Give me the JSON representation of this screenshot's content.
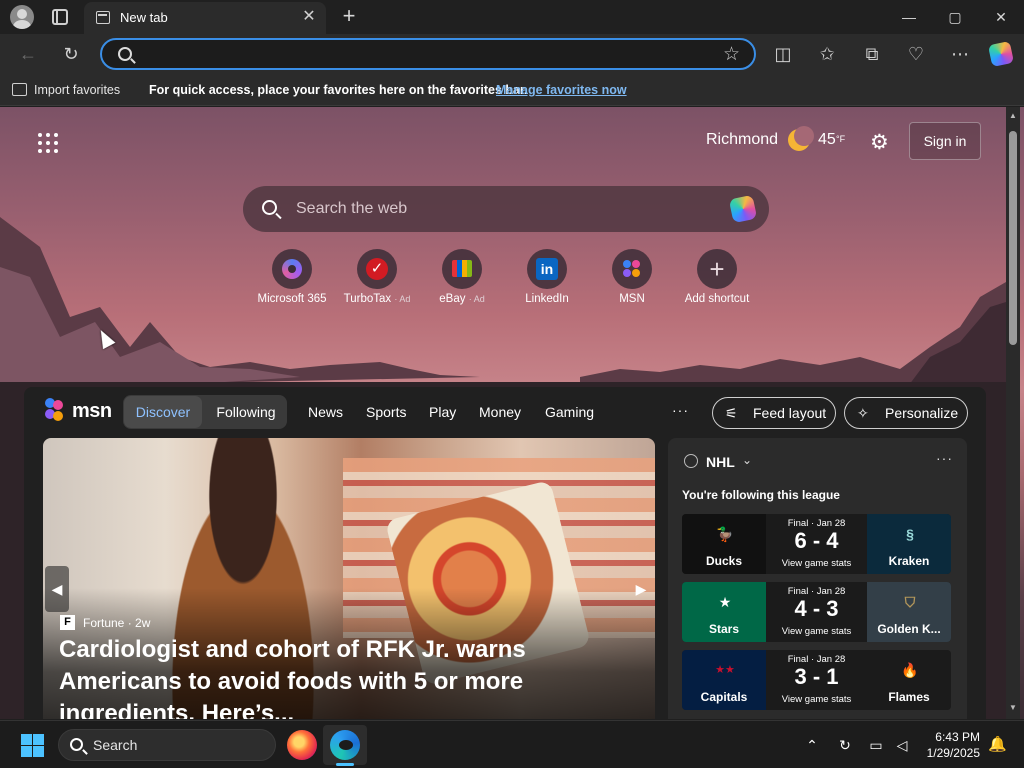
{
  "browser": {
    "tab": {
      "title": "New tab"
    },
    "window_controls": {
      "minimize": "—",
      "maximize": "▢",
      "close": "✕"
    },
    "address_bar": {
      "value": "",
      "placeholder": ""
    },
    "favorites_bar": {
      "import_label": "Import favorites",
      "message": "For quick access, place your favorites here on the favorites bar.",
      "link": "Manage favorites now"
    }
  },
  "newtab": {
    "weather": {
      "city": "Richmond",
      "temp": "45",
      "unit": "°F"
    },
    "sign_in": "Sign in",
    "search": {
      "placeholder": "Search the web"
    },
    "shortcuts": [
      {
        "label": "Microsoft 365",
        "ad": "",
        "icon": "microsoft-365-icon"
      },
      {
        "label": "TurboTax",
        "ad": "· Ad",
        "icon": "turbotax-icon"
      },
      {
        "label": "eBay",
        "ad": "· Ad",
        "icon": "ebay-icon"
      },
      {
        "label": "LinkedIn",
        "ad": "",
        "icon": "linkedin-icon"
      },
      {
        "label": "MSN",
        "ad": "",
        "icon": "msn-icon"
      },
      {
        "label": "Add shortcut",
        "ad": "",
        "icon": "plus-icon"
      }
    ]
  },
  "feed": {
    "brand": "msn",
    "tabs": {
      "discover": "Discover",
      "following": "Following"
    },
    "nav": [
      "News",
      "Sports",
      "Play",
      "Money",
      "Gaming"
    ],
    "more": "···",
    "feed_layout": "Feed layout",
    "personalize": "Personalize",
    "hero": {
      "source": "Fortune",
      "age": "· 2w",
      "headline": "Cardiologist and cohort of RFK Jr. warns Americans to avoid foods with 5 or more ingredients. Here’s..."
    },
    "sports": {
      "league": "NHL",
      "subtitle": "You're following this league",
      "games": [
        {
          "status": "Final · Jan 28",
          "score": "6 - 4",
          "link": "View game stats",
          "home": "Ducks",
          "away": "Kraken",
          "home_color": "#111111",
          "away_color": "#0b2a3c"
        },
        {
          "status": "Final · Jan 28",
          "score": "4 - 3",
          "link": "View game stats",
          "home": "Stars",
          "away": "Golden K...",
          "home_color": "#006847",
          "away_color": "#333f48"
        },
        {
          "status": "Final · Jan 28",
          "score": "3 - 1",
          "link": "View game stats",
          "home": "Capitals",
          "away": "Flames",
          "home_color": "#041e42",
          "away_color": "#1b1b1b"
        }
      ]
    }
  },
  "taskbar": {
    "search_label": "Search",
    "time": "6:43 PM",
    "date": "1/29/2025"
  },
  "colors": {
    "accent": "#3a8ee6",
    "link": "#7fb8f0",
    "taskbar_accent": "#4cc2ff"
  }
}
